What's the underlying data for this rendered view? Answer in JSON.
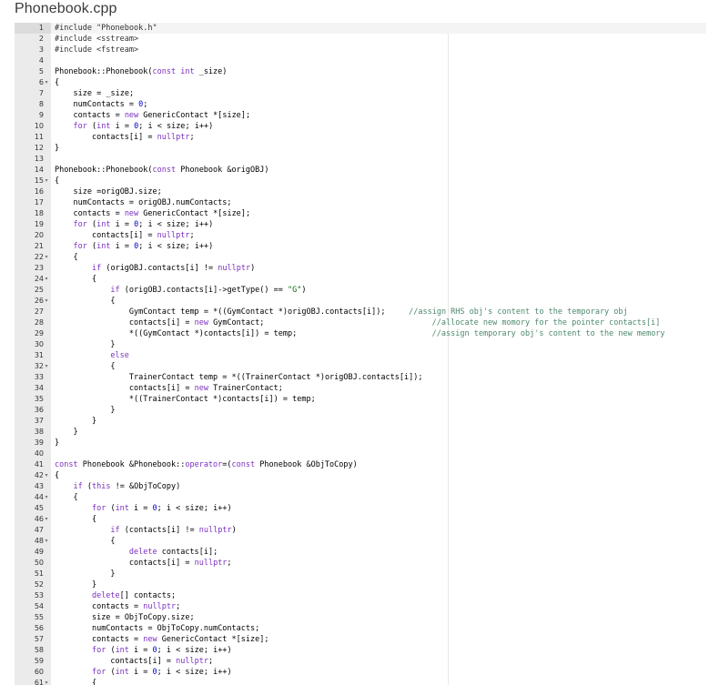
{
  "file": {
    "name": "Phonebook.cpp"
  },
  "editor": {
    "lines": [
      {
        "n": "1",
        "fold": false,
        "active": true,
        "code": "#include \"Phonebook.h\""
      },
      {
        "n": "2",
        "fold": false,
        "code": "#include <sstream>"
      },
      {
        "n": "3",
        "fold": false,
        "code": "#include <fstream>"
      },
      {
        "n": "4",
        "fold": false,
        "code": ""
      },
      {
        "n": "5",
        "fold": false,
        "code": "Phonebook::Phonebook(const int _size)"
      },
      {
        "n": "6",
        "fold": true,
        "code": "{"
      },
      {
        "n": "7",
        "fold": false,
        "code": "    size = _size;"
      },
      {
        "n": "8",
        "fold": false,
        "code": "    numContacts = 0;"
      },
      {
        "n": "9",
        "fold": false,
        "code": "    contacts = new GenericContact *[size];"
      },
      {
        "n": "10",
        "fold": false,
        "code": "    for (int i = 0; i < size; i++)"
      },
      {
        "n": "11",
        "fold": false,
        "code": "        contacts[i] = nullptr;"
      },
      {
        "n": "12",
        "fold": false,
        "code": "}"
      },
      {
        "n": "13",
        "fold": false,
        "code": ""
      },
      {
        "n": "14",
        "fold": false,
        "code": "Phonebook::Phonebook(const Phonebook &origOBJ)"
      },
      {
        "n": "15",
        "fold": true,
        "code": "{"
      },
      {
        "n": "16",
        "fold": false,
        "code": "    size =origOBJ.size;"
      },
      {
        "n": "17",
        "fold": false,
        "code": "    numContacts = origOBJ.numContacts;"
      },
      {
        "n": "18",
        "fold": false,
        "code": "    contacts = new GenericContact *[size];"
      },
      {
        "n": "19",
        "fold": false,
        "code": "    for (int i = 0; i < size; i++)"
      },
      {
        "n": "20",
        "fold": false,
        "code": "        contacts[i] = nullptr;"
      },
      {
        "n": "21",
        "fold": false,
        "code": "    for (int i = 0; i < size; i++)"
      },
      {
        "n": "22",
        "fold": true,
        "code": "    {"
      },
      {
        "n": "23",
        "fold": false,
        "code": "        if (origOBJ.contacts[i] != nullptr)"
      },
      {
        "n": "24",
        "fold": true,
        "code": "        {"
      },
      {
        "n": "25",
        "fold": false,
        "code": "            if (origOBJ.contacts[i]->getType() == \"G\")"
      },
      {
        "n": "26",
        "fold": true,
        "code": "            {"
      },
      {
        "n": "27",
        "fold": false,
        "code": "                GymContact temp = *((GymContact *)origOBJ.contacts[i]);     //assign RHS obj's content to the temporary obj"
      },
      {
        "n": "28",
        "fold": false,
        "code": "                contacts[i] = new GymContact;                                    //allocate new momory for the pointer contacts[i]"
      },
      {
        "n": "29",
        "fold": false,
        "code": "                *((GymContact *)contacts[i]) = temp;                             //assign temporary obj's content to the new memory"
      },
      {
        "n": "30",
        "fold": false,
        "code": "            }"
      },
      {
        "n": "31",
        "fold": false,
        "code": "            else"
      },
      {
        "n": "32",
        "fold": true,
        "code": "            {"
      },
      {
        "n": "33",
        "fold": false,
        "code": "                TrainerContact temp = *((TrainerContact *)origOBJ.contacts[i]);"
      },
      {
        "n": "34",
        "fold": false,
        "code": "                contacts[i] = new TrainerContact;"
      },
      {
        "n": "35",
        "fold": false,
        "code": "                *((TrainerContact *)contacts[i]) = temp;"
      },
      {
        "n": "36",
        "fold": false,
        "code": "            }"
      },
      {
        "n": "37",
        "fold": false,
        "code": "        }"
      },
      {
        "n": "38",
        "fold": false,
        "code": "    }"
      },
      {
        "n": "39",
        "fold": false,
        "code": "}"
      },
      {
        "n": "40",
        "fold": false,
        "code": ""
      },
      {
        "n": "41",
        "fold": false,
        "code": "const Phonebook &Phonebook::operator=(const Phonebook &ObjToCopy)"
      },
      {
        "n": "42",
        "fold": true,
        "code": "{"
      },
      {
        "n": "43",
        "fold": false,
        "code": "    if (this != &ObjToCopy)"
      },
      {
        "n": "44",
        "fold": true,
        "code": "    {"
      },
      {
        "n": "45",
        "fold": false,
        "code": "        for (int i = 0; i < size; i++)"
      },
      {
        "n": "46",
        "fold": true,
        "code": "        {"
      },
      {
        "n": "47",
        "fold": false,
        "code": "            if (contacts[i] != nullptr)"
      },
      {
        "n": "48",
        "fold": true,
        "code": "            {"
      },
      {
        "n": "49",
        "fold": false,
        "code": "                delete contacts[i];"
      },
      {
        "n": "50",
        "fold": false,
        "code": "                contacts[i] = nullptr;"
      },
      {
        "n": "51",
        "fold": false,
        "code": "            }"
      },
      {
        "n": "52",
        "fold": false,
        "code": "        }"
      },
      {
        "n": "53",
        "fold": false,
        "code": "        delete[] contacts;"
      },
      {
        "n": "54",
        "fold": false,
        "code": "        contacts = nullptr;"
      },
      {
        "n": "55",
        "fold": false,
        "code": "        size = ObjToCopy.size;"
      },
      {
        "n": "56",
        "fold": false,
        "code": "        numContacts = ObjToCopy.numContacts;"
      },
      {
        "n": "57",
        "fold": false,
        "code": "        contacts = new GenericContact *[size];"
      },
      {
        "n": "58",
        "fold": false,
        "code": "        for (int i = 0; i < size; i++)"
      },
      {
        "n": "59",
        "fold": false,
        "code": "            contacts[i] = nullptr;"
      },
      {
        "n": "60",
        "fold": false,
        "code": "        for (int i = 0; i < size; i++)"
      },
      {
        "n": "61",
        "fold": true,
        "code": "        {"
      }
    ]
  }
}
